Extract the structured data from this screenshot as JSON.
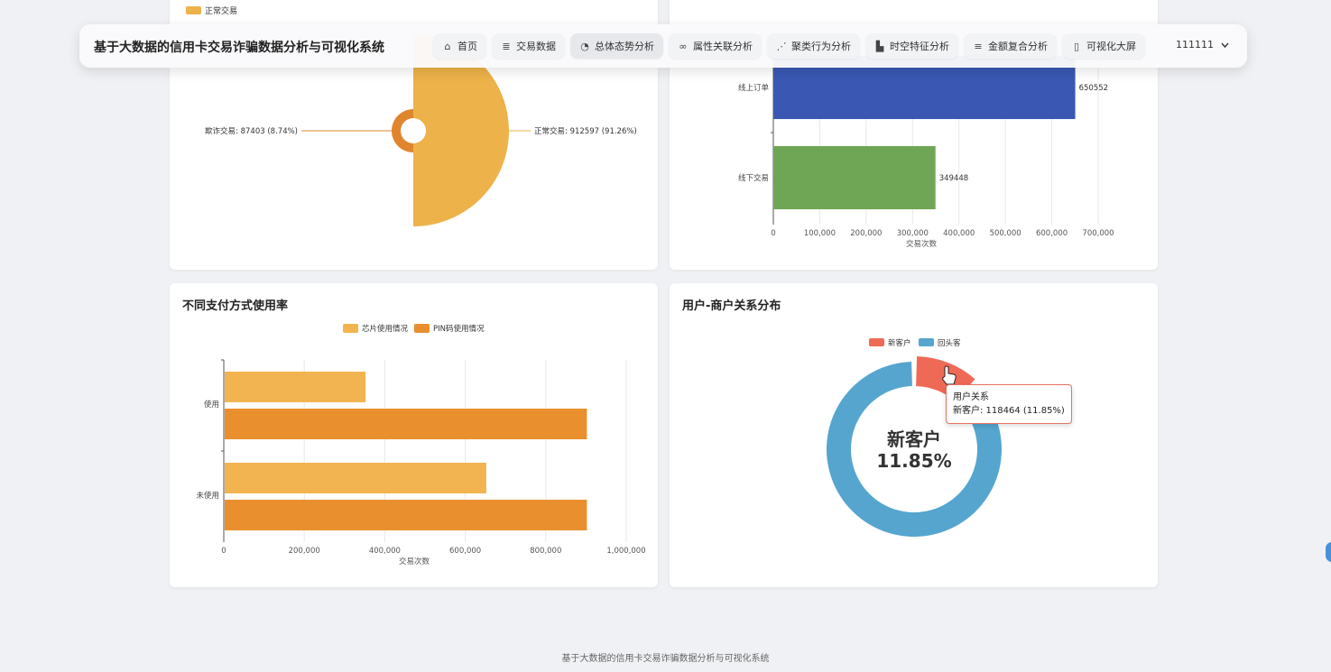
{
  "app_title": "基于大数据的信用卡交易诈骗数据分析与可视化系统",
  "nav": [
    {
      "label": "首页",
      "icon": "home-icon",
      "glyph": "⌂"
    },
    {
      "label": "交易数据",
      "icon": "database-icon",
      "glyph": "≣"
    },
    {
      "label": "总体态势分析",
      "icon": "pie-chart-icon",
      "glyph": "◔"
    },
    {
      "label": "属性关联分析",
      "icon": "link-icon",
      "glyph": "∞"
    },
    {
      "label": "聚类行为分析",
      "icon": "cluster-icon",
      "glyph": "⋰"
    },
    {
      "label": "时空特征分析",
      "icon": "map-icon",
      "glyph": "▙"
    },
    {
      "label": "金额复合分析",
      "icon": "coins-icon",
      "glyph": "≡"
    },
    {
      "label": "可视化大屏",
      "icon": "screen-icon",
      "glyph": "▯"
    }
  ],
  "user": {
    "name": "111111",
    "chevron": "chevron-down-icon"
  },
  "footer": "基于大数据的信用卡交易诈骗数据分析与可视化系统",
  "chart_data": [
    {
      "type": "pie",
      "legend": [
        "正常交易"
      ],
      "slices": [
        {
          "name": "欺诈交易",
          "value": 87403,
          "percent": 8.74,
          "label": "欺诈交易: 87403 (8.74%)",
          "color": "#e0852e"
        },
        {
          "name": "正常交易",
          "value": 912597,
          "percent": 91.26,
          "label": "正常交易: 912597 (91.26%)",
          "color": "#edb24a"
        }
      ]
    },
    {
      "type": "bar",
      "orientation": "horizontal",
      "categories": [
        "线上订单",
        "线下交易"
      ],
      "values": [
        650552,
        349448
      ],
      "colors": [
        "#3a58b3",
        "#6ea656"
      ],
      "xlabel": "交易次数",
      "xlim": [
        0,
        700000
      ],
      "ticks": [
        "0",
        "100,000",
        "200,000",
        "300,000",
        "400,000",
        "500,000",
        "600,000",
        "700,000"
      ]
    },
    {
      "type": "bar",
      "orientation": "horizontal",
      "title": "不同支付方式使用率",
      "categories": [
        "使用",
        "未使用"
      ],
      "series": [
        {
          "name": "芯片使用情况",
          "values": [
            350000,
            650000
          ],
          "color": "#f2b450"
        },
        {
          "name": "PIN码使用情况",
          "values": [
            900000,
            900000
          ],
          "color": "#e98f2e"
        }
      ],
      "xlabel": "交易次数",
      "xlim": [
        0,
        1000000
      ],
      "ticks": [
        "0",
        "200,000",
        "400,000",
        "600,000",
        "800,000",
        "1,000,000"
      ]
    },
    {
      "type": "pie",
      "title": "用户-商户关系分布",
      "legend": [
        "新客户",
        "回头客"
      ],
      "slices": [
        {
          "name": "新客户",
          "value": 118464,
          "percent": 11.85,
          "color": "#ef6a56"
        },
        {
          "name": "回头客",
          "value": 881536,
          "percent": 88.15,
          "color": "#55a5cf"
        }
      ],
      "center_label": "新客户",
      "center_value": "11.85%",
      "tooltip_title": "用户关系",
      "tooltip_text": "新客户: 118464 (11.85%)"
    }
  ]
}
